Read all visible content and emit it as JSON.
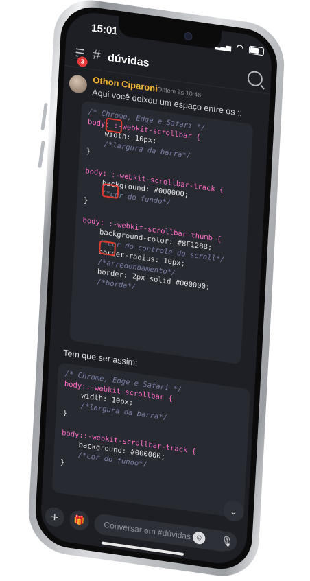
{
  "status": {
    "time": "15:01"
  },
  "header": {
    "channel": "dúvidas",
    "unread": "3"
  },
  "message": {
    "author": "Othon Ciparoni",
    "timestamp": "Ontem às 10:46",
    "text": "Aqui você deixou um espaço entre os ::",
    "after_text": "Tem que ser assim:"
  },
  "code_block_1": [
    "/* Chrome, Edge e Safari */",
    "body: :-webkit-scrollbar {",
    "    width: 10px;",
    "    /*largura da barra*/",
    "}",
    "body: :-webkit-scrollbar-track {",
    "    background: #000000;",
    "    /*cor do fundo*/",
    "}",
    "body: :-webkit-scrollbar-thumb {",
    "    background-color: #8F128B;",
    "    /*cor do controle do scroll*/",
    "    border-radius: 10px;",
    "    /*arredondamento*/",
    "    border: 2px solid #000000;",
    "    /*borda*/"
  ],
  "code_block_2": [
    "/* Chrome, Edge e Safari */",
    "body::-webkit-scrollbar {",
    "    width: 10px;",
    "    /*largura da barra*/",
    "}",
    "body::-webkit-scrollbar-track {",
    "    background: #000000;",
    "    /*cor do fundo*/",
    "}"
  ],
  "composer": {
    "placeholder": "Conversar em #dúvidas"
  },
  "colors": {
    "author": "#f0b232",
    "purple_swatch": "#8F128B",
    "red_highlight": "#e03b2f"
  },
  "icons": [
    "hamburger-icon",
    "hash-icon",
    "search-icon",
    "plus-icon",
    "gift-icon",
    "emoji-icon",
    "mic-icon",
    "chevron-down-icon"
  ]
}
